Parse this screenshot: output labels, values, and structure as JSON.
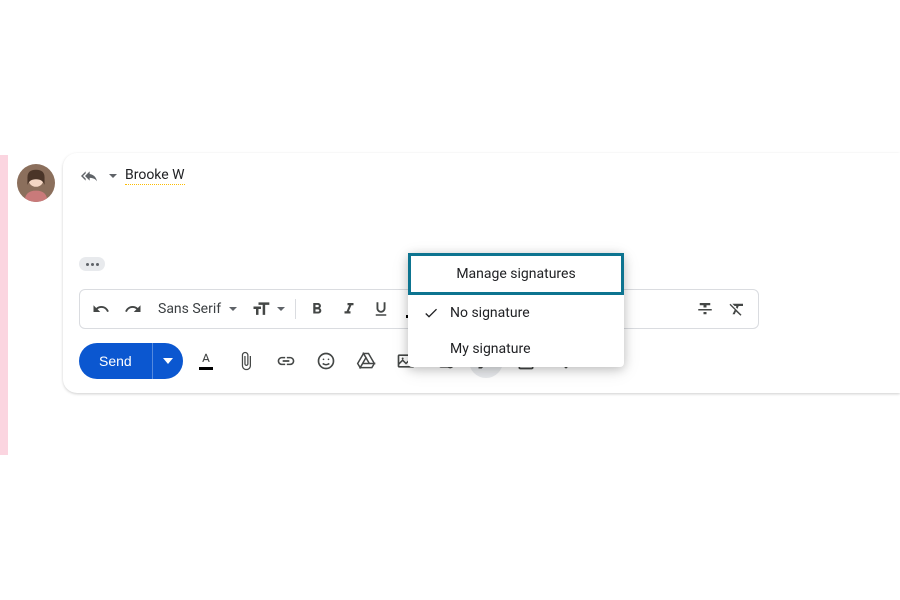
{
  "recipient": {
    "name": "Brooke W"
  },
  "format_toolbar": {
    "font": "Sans Serif"
  },
  "send": {
    "label": "Send"
  },
  "signature_menu": {
    "manage": "Manage signatures",
    "items": [
      {
        "label": "No signature",
        "checked": true
      },
      {
        "label": "My signature",
        "checked": false
      }
    ]
  }
}
